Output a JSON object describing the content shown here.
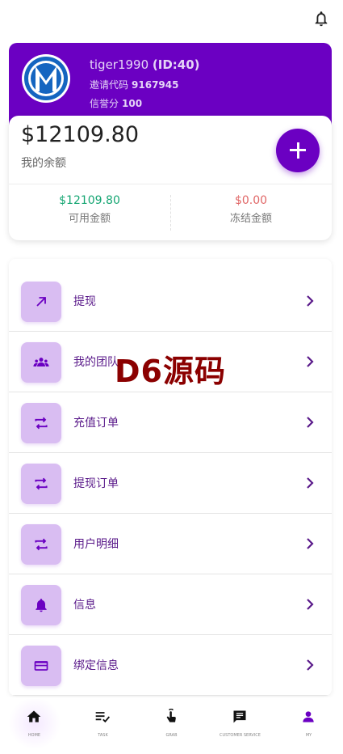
{
  "colors": {
    "primary": "#6b00c2",
    "green": "#16a673",
    "red": "#e06666",
    "icon_bg": "#d9bdf2"
  },
  "profile": {
    "username": "tiger1990",
    "id_text": "(ID:40)",
    "invite_label": "邀请代码",
    "invite_code": "9167945",
    "credit_label": "信誉分",
    "credit_value": "100"
  },
  "balance": {
    "amount": "$12109.80",
    "label": "我的余额",
    "available_amount": "$12109.80",
    "available_label": "可用金额",
    "frozen_amount": "$0.00",
    "frozen_label": "冻结金额"
  },
  "menu": [
    {
      "label": "提现",
      "icon": "arrow-up-right-icon"
    },
    {
      "label": "我的团队",
      "icon": "group-icon"
    },
    {
      "label": "充值订单",
      "icon": "swap-icon"
    },
    {
      "label": "提现订单",
      "icon": "swap-icon"
    },
    {
      "label": "用户明细",
      "icon": "swap-icon"
    },
    {
      "label": "信息",
      "icon": "bell-icon"
    },
    {
      "label": "绑定信息",
      "icon": "card-icon"
    }
  ],
  "watermark": "D6源码",
  "nav": [
    {
      "label": "HOME",
      "icon": "home-icon"
    },
    {
      "label": "TASK",
      "icon": "task-icon"
    },
    {
      "label": "GRAB",
      "icon": "grab-icon"
    },
    {
      "label": "CUSTOMER SERVICE",
      "icon": "chat-icon"
    },
    {
      "label": "MY",
      "icon": "person-icon",
      "active": true
    }
  ]
}
